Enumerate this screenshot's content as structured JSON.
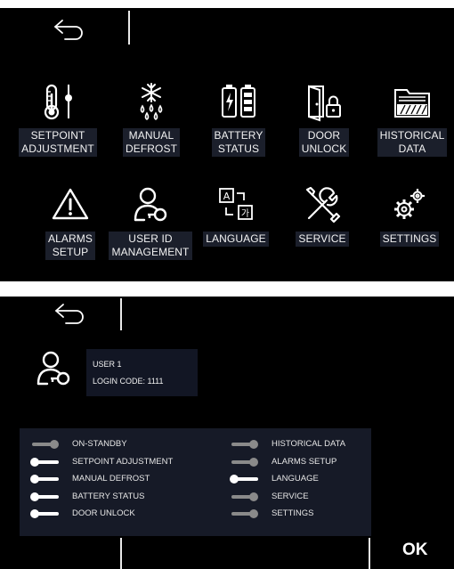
{
  "menu_screen": {
    "back_icon": "back-arrow-icon",
    "row1": [
      {
        "label_line1": "SETPOINT",
        "label_line2": "ADJUSTMENT",
        "icon": "thermometer-icon"
      },
      {
        "label_line1": "MANUAL",
        "label_line2": "DEFROST",
        "icon": "snowflake-defrost-icon"
      },
      {
        "label_line1": "BATTERY",
        "label_line2": "STATUS",
        "icon": "battery-icon"
      },
      {
        "label_line1": "DOOR",
        "label_line2": "UNLOCK",
        "icon": "door-unlock-icon"
      },
      {
        "label_line1": "HISTORICAL",
        "label_line2": "DATA",
        "icon": "folder-icon"
      }
    ],
    "row2": [
      {
        "label_line1": "ALARMS",
        "label_line2": "SETUP",
        "icon": "warning-icon"
      },
      {
        "label_line1": "USER ID",
        "label_line2": "MANAGEMENT",
        "icon": "user-key-icon"
      },
      {
        "label_line1": "LANGUAGE",
        "label_line2": "",
        "icon": "language-icon"
      },
      {
        "label_line1": "SERVICE",
        "label_line2": "",
        "icon": "tools-icon"
      },
      {
        "label_line1": "SETTINGS",
        "label_line2": "",
        "icon": "gears-icon"
      }
    ]
  },
  "user_screen": {
    "user_name": "USER 1",
    "login_code": "LOGIN CODE: 1111",
    "permissions_left": [
      {
        "label": "ON-STANDBY",
        "enabled": false
      },
      {
        "label": "SETPOINT ADJUSTMENT",
        "enabled": true
      },
      {
        "label": "MANUAL DEFROST",
        "enabled": true
      },
      {
        "label": "BATTERY STATUS",
        "enabled": true
      },
      {
        "label": "DOOR UNLOCK",
        "enabled": true
      }
    ],
    "permissions_right": [
      {
        "label": "HISTORICAL DATA",
        "enabled": false
      },
      {
        "label": "ALARMS SETUP",
        "enabled": false
      },
      {
        "label": "LANGUAGE",
        "enabled": true
      },
      {
        "label": "SERVICE",
        "enabled": false
      },
      {
        "label": "SETTINGS",
        "enabled": false
      }
    ],
    "ok_label": "OK"
  },
  "colors": {
    "toggle_on": "#ffffff",
    "toggle_off": "#8a8a8a",
    "label_bg": "#1b1f2b"
  }
}
